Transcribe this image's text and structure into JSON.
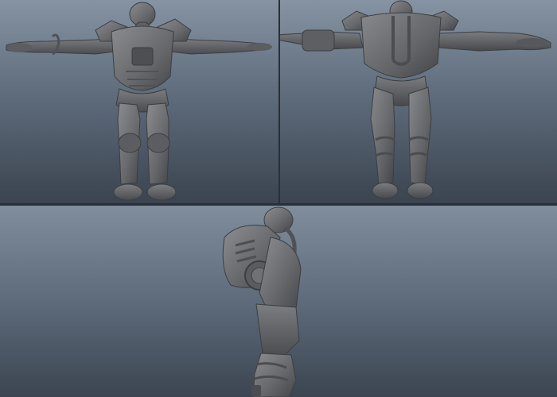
{
  "viewports": [
    {
      "id": "front",
      "view": "front",
      "model": "armored-robot-t-pose"
    },
    {
      "id": "back",
      "view": "back",
      "model": "armored-robot-t-pose"
    },
    {
      "id": "side",
      "view": "side",
      "model": "armored-robot-t-pose"
    }
  ],
  "colors": {
    "background_top": "#8593a3",
    "background_bottom": "#3b4450",
    "model_shade": "#6b6d70",
    "model_dark": "#3f4144",
    "model_light": "#8e9093",
    "divider": "#2a2f36"
  }
}
